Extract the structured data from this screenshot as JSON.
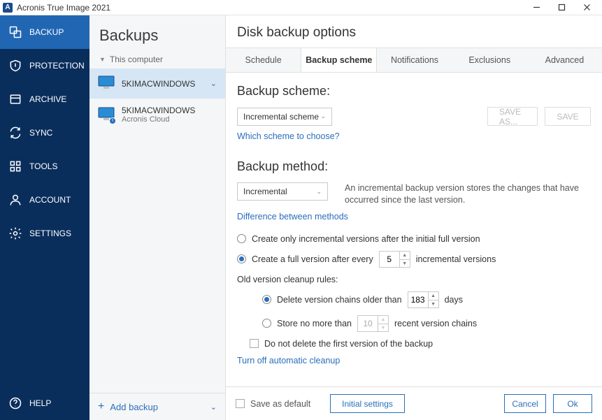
{
  "window": {
    "app_title": "Acronis True Image 2021",
    "logo_letter": "A"
  },
  "nav": {
    "items": [
      {
        "label": "BACKUP"
      },
      {
        "label": "PROTECTION"
      },
      {
        "label": "ARCHIVE"
      },
      {
        "label": "SYNC"
      },
      {
        "label": "TOOLS"
      },
      {
        "label": "ACCOUNT"
      },
      {
        "label": "SETTINGS"
      }
    ],
    "help_label": "HELP"
  },
  "list": {
    "header": "Backups",
    "section_label": "This computer",
    "items": [
      {
        "name": "5KIMACWINDOWS",
        "sub": ""
      },
      {
        "name": "5KIMACWINDOWS",
        "sub": "Acronis Cloud"
      }
    ],
    "add_label": "Add backup"
  },
  "content": {
    "title": "Disk backup options",
    "tabs": [
      {
        "label": "Schedule"
      },
      {
        "label": "Backup scheme"
      },
      {
        "label": "Notifications"
      },
      {
        "label": "Exclusions"
      },
      {
        "label": "Advanced"
      }
    ],
    "scheme": {
      "heading": "Backup scheme:",
      "combo_value": "Incremental scheme",
      "save_as": "SAVE AS...",
      "save": "SAVE",
      "choose_link": "Which scheme to choose?"
    },
    "method": {
      "heading": "Backup method:",
      "combo_value": "Incremental",
      "description": "An incremental backup version stores the changes that have occurred since the last version.",
      "diff_link": "Difference between methods",
      "radio1": "Create only incremental versions after the initial full version",
      "radio2_prefix": "Create a full version after every",
      "radio2_value": "5",
      "radio2_suffix": "incremental versions",
      "cleanup_header": "Old version cleanup rules:",
      "cleanup_r1_prefix": "Delete version chains older than",
      "cleanup_r1_value": "183",
      "cleanup_r1_suffix": "days",
      "cleanup_r2_prefix": "Store no more than",
      "cleanup_r2_value": "10",
      "cleanup_r2_suffix": "recent version chains",
      "no_delete_first": "Do not delete the first version of the backup",
      "turn_off_link": "Turn off automatic cleanup"
    },
    "footer": {
      "save_default": "Save as default",
      "initial": "Initial settings",
      "cancel": "Cancel",
      "ok": "Ok"
    }
  }
}
